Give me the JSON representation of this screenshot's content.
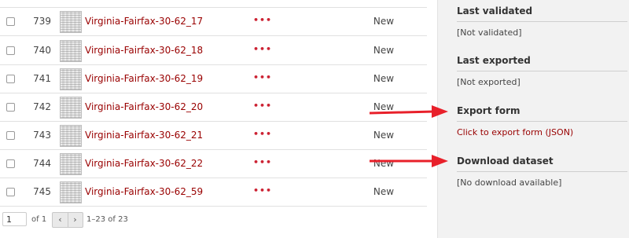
{
  "table": {
    "rows": [
      {
        "num": "739",
        "name": "Virginia-Fairfax-30-62_17",
        "status": "New"
      },
      {
        "num": "740",
        "name": "Virginia-Fairfax-30-62_18",
        "status": "New"
      },
      {
        "num": "741",
        "name": "Virginia-Fairfax-30-62_19",
        "status": "New"
      },
      {
        "num": "742",
        "name": "Virginia-Fairfax-30-62_20",
        "status": "New"
      },
      {
        "num": "743",
        "name": "Virginia-Fairfax-30-62_21",
        "status": "New"
      },
      {
        "num": "744",
        "name": "Virginia-Fairfax-30-62_22",
        "status": "New"
      },
      {
        "num": "745",
        "name": "Virginia-Fairfax-30-62_59",
        "status": "New"
      }
    ],
    "actions_glyph": "•••"
  },
  "pager": {
    "page_value": "1",
    "of_text": "of 1",
    "prev_glyph": "‹",
    "next_glyph": "›",
    "range_text": "1–23 of 23"
  },
  "panel": {
    "last_validated": {
      "heading": "Last validated",
      "value": "[Not validated]"
    },
    "last_exported": {
      "heading": "Last exported",
      "value": "[Not exported]"
    },
    "export_form": {
      "heading": "Export form",
      "link": "Click to export form (JSON)"
    },
    "download_dataset": {
      "heading": "Download dataset",
      "value": "[No download available]"
    }
  },
  "colors": {
    "link": "#990000",
    "arrow": "#e8202a",
    "panel_bg": "#f2f2f2"
  }
}
